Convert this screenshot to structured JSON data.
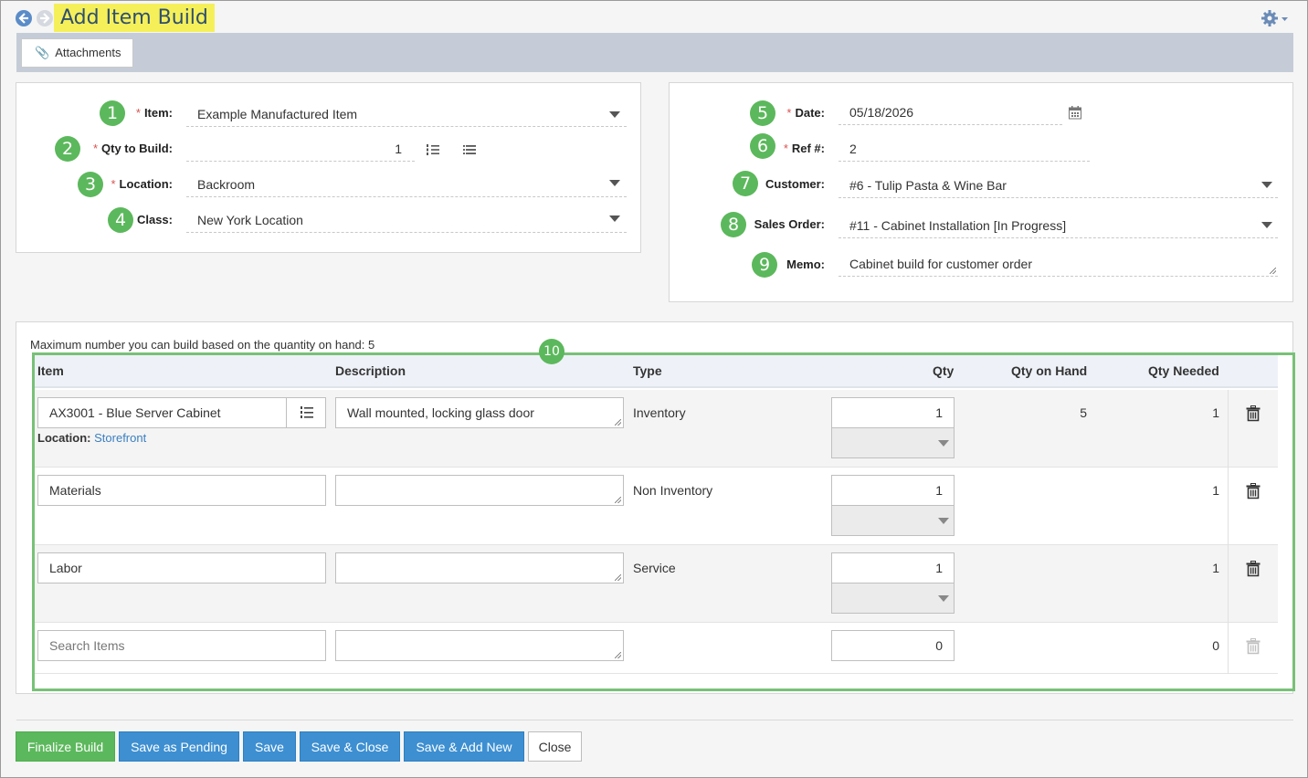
{
  "header": {
    "title": "Add Item Build"
  },
  "tabs": {
    "attachments": "Attachments"
  },
  "left_form": {
    "item": {
      "badge": "1",
      "required": "*",
      "label": "Item:",
      "value": "Example Manufactured Item"
    },
    "qty": {
      "badge": "2",
      "required": "*",
      "label": "Qty to Build:",
      "value": "1"
    },
    "location": {
      "badge": "3",
      "required": "*",
      "label": "Location:",
      "value": "Backroom"
    },
    "class": {
      "badge": "4",
      "label": "Class:",
      "value": "New York Location"
    }
  },
  "right_form": {
    "date": {
      "badge": "5",
      "required": "*",
      "label": "Date:",
      "value": "05/18/2026"
    },
    "ref": {
      "badge": "6",
      "required": "*",
      "label": "Ref #:",
      "value": "2"
    },
    "customer": {
      "badge": "7",
      "label": "Customer:",
      "value": "#6 - Tulip Pasta & Wine Bar"
    },
    "sales_order": {
      "badge": "8",
      "label": "Sales Order:",
      "value": "#11 - Cabinet Installation [In Progress]"
    },
    "memo": {
      "badge": "9",
      "label": "Memo:",
      "value": "Cabinet build for customer order"
    }
  },
  "grid": {
    "info": "Maximum number you can build based on the quantity on hand: 5",
    "badge": "10",
    "columns": {
      "item": "Item",
      "description": "Description",
      "type": "Type",
      "qty": "Qty",
      "qty_on_hand": "Qty on Hand",
      "qty_needed": "Qty Needed"
    },
    "rows": [
      {
        "item": "AX3001 - Blue Server Cabinet",
        "location_label": "Location:",
        "location_value": "Storefront",
        "description": "Wall mounted, locking glass door",
        "type": "Inventory",
        "qty": "1",
        "qty_on_hand": "5",
        "qty_needed": "1"
      },
      {
        "item": "Materials",
        "description": "",
        "type": "Non Inventory",
        "qty": "1",
        "qty_on_hand": "",
        "qty_needed": "1"
      },
      {
        "item": "Labor",
        "description": "",
        "type": "Service",
        "qty": "1",
        "qty_on_hand": "",
        "qty_needed": "1"
      }
    ],
    "new_row": {
      "placeholder": "Search Items",
      "qty": "0",
      "qty_needed": "0"
    }
  },
  "footer": {
    "finalize": "Finalize Build",
    "pending": "Save as Pending",
    "save": "Save",
    "save_close": "Save & Close",
    "save_new": "Save & Add New",
    "close": "Close"
  },
  "colors": {
    "badge": "#5cb85c",
    "primary": "#3d8fd1",
    "success": "#5cb85c",
    "title_highlight": "#f5f05a",
    "grid_outline": "#78c178"
  },
  "icons": [
    "back-arrow-icon",
    "forward-arrow-icon",
    "gear-icon",
    "paperclip-icon",
    "dropdown-caret-icon",
    "calendar-icon",
    "numbered-list-icon",
    "list-icon",
    "trash-icon"
  ]
}
